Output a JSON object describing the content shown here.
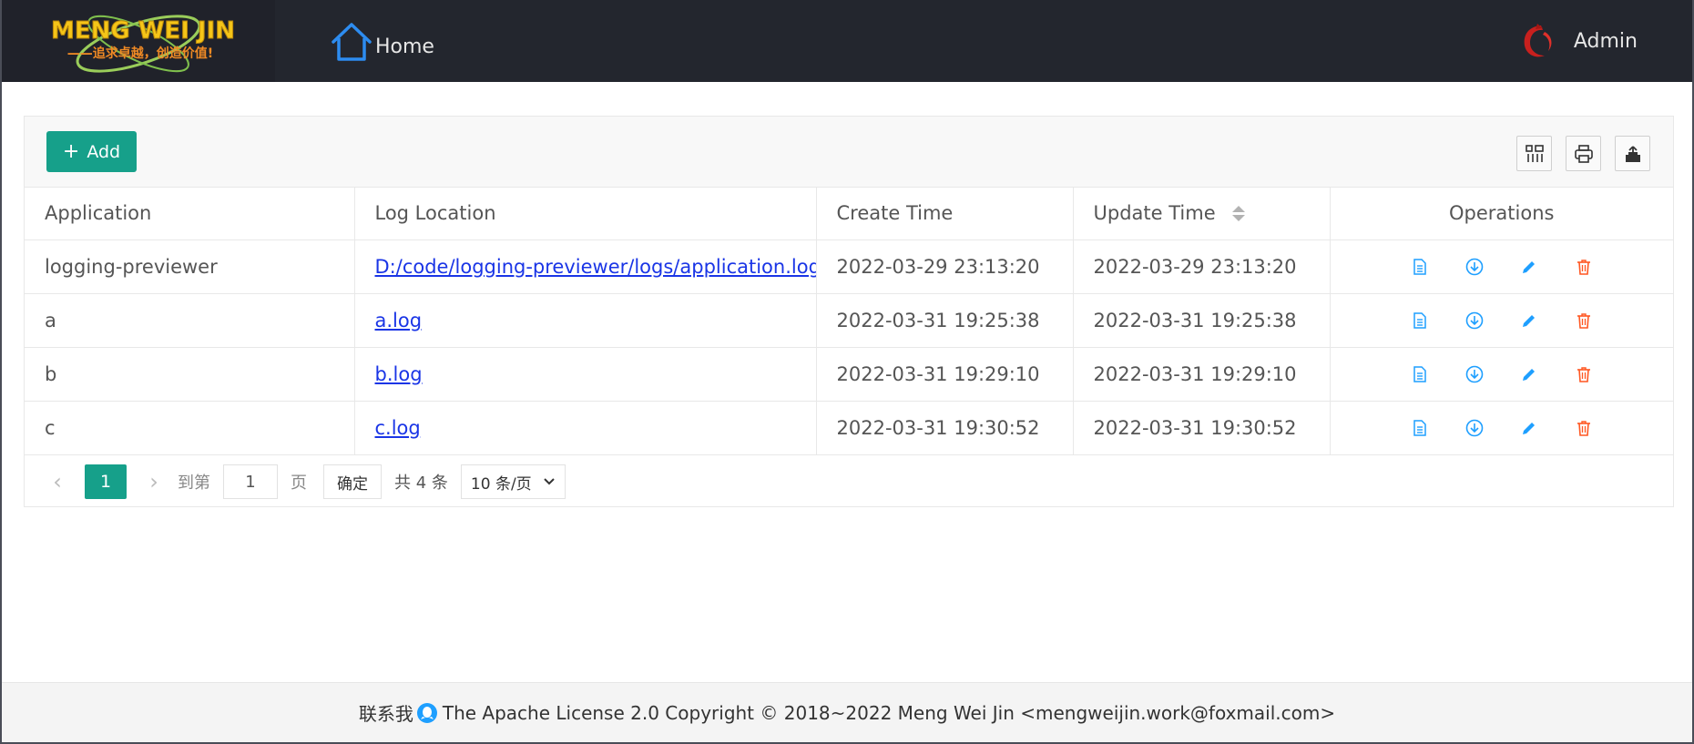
{
  "header": {
    "logo_title": "MENG WEI JIN",
    "logo_slogan": "——追求卓越，创造价值!",
    "nav_home": "Home",
    "user": "Admin"
  },
  "toolbar": {
    "add_label": "Add",
    "tools": [
      "columns-icon",
      "print-icon",
      "export-icon"
    ]
  },
  "table": {
    "columns": [
      "Application",
      "Log Location",
      "Create Time",
      "Update Time",
      "Operations"
    ],
    "rows": [
      {
        "application": "logging-previewer",
        "log_location": "D:/code/logging-previewer/logs/application.log",
        "create_time": "2022-03-29 23:13:20",
        "update_time": "2022-03-29 23:13:20"
      },
      {
        "application": "a",
        "log_location": "a.log",
        "create_time": "2022-03-31 19:25:38",
        "update_time": "2022-03-31 19:25:38"
      },
      {
        "application": "b",
        "log_location": "b.log",
        "create_time": "2022-03-31 19:29:10",
        "update_time": "2022-03-31 19:29:10"
      },
      {
        "application": "c",
        "log_location": "c.log",
        "create_time": "2022-03-31 19:30:52",
        "update_time": "2022-03-31 19:30:52"
      }
    ],
    "operation_icons": [
      "view-icon",
      "download-icon",
      "edit-icon",
      "delete-icon"
    ]
  },
  "pagination": {
    "current_page": "1",
    "goto_prefix": "到第",
    "goto_value": "1",
    "goto_suffix": "页",
    "confirm": "确定",
    "total": "共 4 条",
    "page_size": "10 条/页"
  },
  "footer": {
    "contact": "联系我",
    "text": "The Apache License 2.0 Copyright © 2018~2022 Meng Wei Jin <mengweijin.work@foxmail.com>"
  },
  "colors": {
    "header_bg": "#23262e",
    "accent": "#16a08a",
    "link": "#1a35e6",
    "op_blue": "#1e9fff",
    "op_red": "#ff5722"
  }
}
